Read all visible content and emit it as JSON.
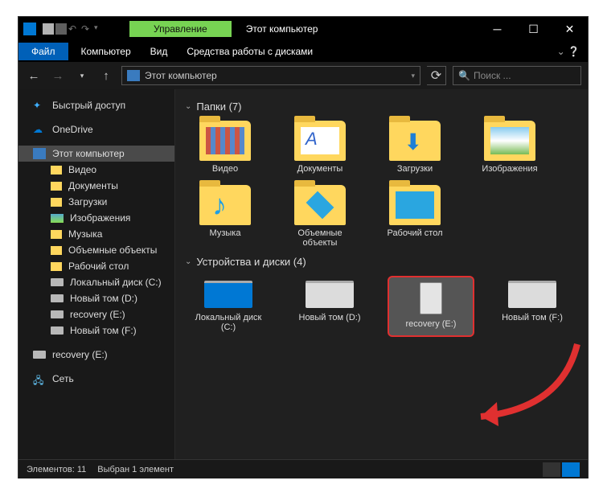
{
  "titlebar": {
    "tools_tab": "Управление",
    "title": "Этот компьютер"
  },
  "menubar": {
    "file": "Файл",
    "items": [
      "Компьютер",
      "Вид",
      "Средства работы с дисками"
    ]
  },
  "nav": {
    "breadcrumb": "Этот компьютер",
    "search_placeholder": "Поиск ..."
  },
  "sidebar": {
    "quick_access": "Быстрый доступ",
    "onedrive": "OneDrive",
    "this_pc": "Этот компьютер",
    "items": [
      "Видео",
      "Документы",
      "Загрузки",
      "Изображения",
      "Музыка",
      "Объемные объекты",
      "Рабочий стол",
      "Локальный диск (C:)",
      "Новый том (D:)",
      "recovery (E:)",
      "Новый том (F:)"
    ],
    "recovery_dup": "recovery (E:)",
    "network": "Сеть"
  },
  "content": {
    "folders_header": "Папки (7)",
    "folders": [
      "Видео",
      "Документы",
      "Загрузки",
      "Изображения",
      "Музыка",
      "Объемные объекты",
      "Рабочий стол"
    ],
    "drives_header": "Устройства и диски (4)",
    "drives": [
      "Локальный диск (C:)",
      "Новый том (D:)",
      "recovery (E:)",
      "Новый том (F:)"
    ]
  },
  "statusbar": {
    "count": "Элементов: 11",
    "selected": "Выбран 1 элемент"
  }
}
